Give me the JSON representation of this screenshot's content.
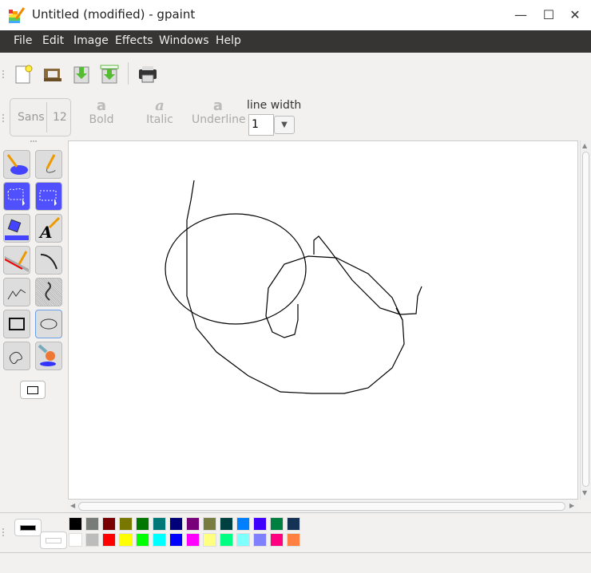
{
  "window": {
    "title": "Untitled (modified) - gpaint",
    "minimize": "—",
    "maximize": "☐",
    "close": "✕"
  },
  "menu": [
    "File",
    "Edit",
    "Image",
    "Effects",
    "Windows",
    "Help"
  ],
  "toolbar": {
    "icons": [
      "new-icon",
      "open-icon",
      "save-icon",
      "save-as-icon",
      "print-icon"
    ]
  },
  "text_toolbar": {
    "font": "Sans",
    "size": "12",
    "bold": "Bold",
    "italic": "Italic",
    "underline": "Underline",
    "line_width_label": "line width",
    "line_width": "1",
    "bold_glyph": "a",
    "italic_glyph": "a",
    "underline_glyph": "a"
  },
  "tools": [
    "paint-bucket-select",
    "freehand-pencil",
    "lasso-select",
    "rect-select",
    "fill",
    "text",
    "line",
    "curve",
    "polyline",
    "freehand-multiline",
    "rectangle",
    "ellipse",
    "closed-freehand",
    "paintbrush"
  ],
  "selected_tool": "ellipse",
  "colors": {
    "foreground": "#000000",
    "background": "#ffffff",
    "palette_row1": [
      "#000000",
      "#787c78",
      "#780000",
      "#787800",
      "#007800",
      "#007878",
      "#000078",
      "#780078",
      "#787c40",
      "#004040",
      "#0080ff",
      "#4000ff",
      "#008040",
      "#143254"
    ],
    "palette_row2": [
      "#ffffff",
      "#bcbcbc",
      "#ff0000",
      "#ffff00",
      "#00ff00",
      "#00ffff",
      "#0000ff",
      "#ff00ff",
      "#ffff80",
      "#00ff80",
      "#80ffff",
      "#8080ff",
      "#ff0080",
      "#ff8040"
    ]
  }
}
